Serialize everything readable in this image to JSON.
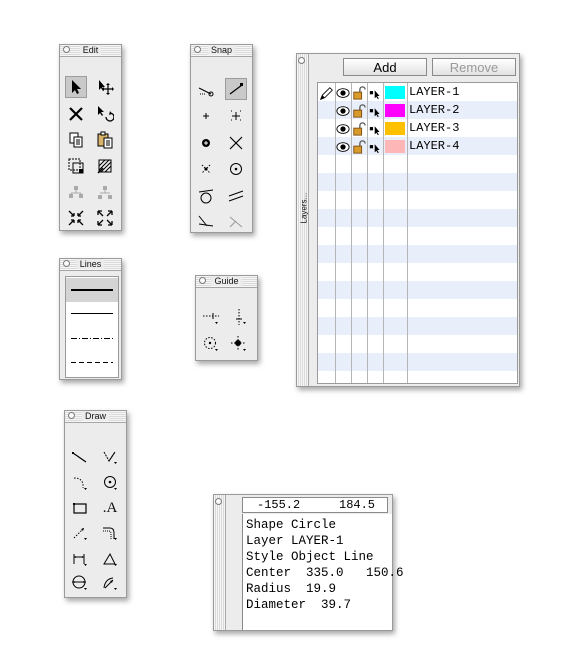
{
  "edit": {
    "title": "Edit",
    "tools": [
      {
        "name": "select-arrow-icon",
        "glyph": "➤"
      },
      {
        "name": "move-icon",
        "glyph": "✥"
      },
      {
        "name": "delete-icon",
        "glyph": "✕"
      },
      {
        "name": "rotate-icon",
        "glyph": "↻"
      },
      {
        "name": "copy-icon",
        "glyph": "⎘"
      },
      {
        "name": "paste-icon",
        "glyph": "📋"
      },
      {
        "name": "select-box-icon",
        "glyph": "⬚"
      },
      {
        "name": "hatch-icon",
        "glyph": "▨"
      },
      {
        "name": "group-icon",
        "glyph": "⁂"
      },
      {
        "name": "ungroup-icon",
        "glyph": "⁂"
      },
      {
        "name": "shrink-icon",
        "glyph": "⤡"
      },
      {
        "name": "expand-icon",
        "glyph": "⤢"
      }
    ]
  },
  "snap": {
    "title": "Snap"
  },
  "lines": {
    "title": "Lines"
  },
  "guide": {
    "title": "Guide"
  },
  "draw": {
    "title": "Draw",
    "text_tool": ".A"
  },
  "layers": {
    "side_title": "Layers...",
    "add_label": "Add",
    "remove_label": "Remove",
    "rows": [
      {
        "name": "LAYER-1",
        "color": "#00ffff"
      },
      {
        "name": "LAYER-2",
        "color": "#ff00ff"
      },
      {
        "name": "LAYER-3",
        "color": "#ffc000"
      },
      {
        "name": "LAYER-4",
        "color": "#ffb6b6"
      }
    ]
  },
  "info": {
    "x": "-155.2",
    "y": "184.5",
    "lines": [
      "Shape Circle",
      "Layer LAYER-1",
      "Style Object Line",
      "Center  335.0   150.6",
      "Radius  19.9",
      "Diameter  39.7"
    ]
  }
}
